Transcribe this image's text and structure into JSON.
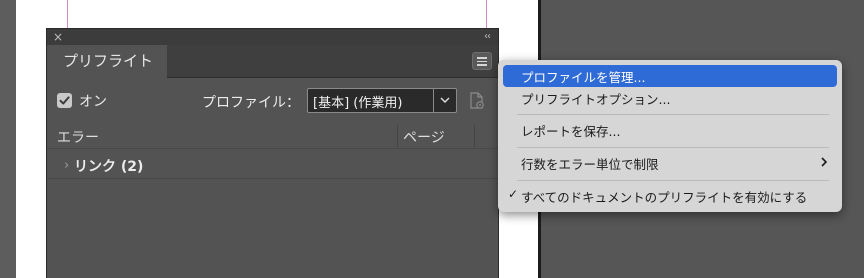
{
  "panel": {
    "tab_label": "プリフライト",
    "close_glyph": "×",
    "collapse_glyph": "‹‹",
    "on_label": "オン",
    "on_checked": true,
    "profile_label": "プロファイル：",
    "profile_value": "[基本] (作業用)",
    "columns": {
      "error": "エラー",
      "page": "ページ"
    },
    "rows": [
      {
        "label": "リンク (2)"
      }
    ]
  },
  "menu": {
    "items": [
      {
        "label": "プロファイルを管理...",
        "highlighted": true
      },
      {
        "label": "プリフライトオプション..."
      },
      {
        "label": "レポートを保存..."
      },
      {
        "label": "行数をエラー単位で制限",
        "submenu": true
      },
      {
        "label": "すべてのドキュメントのプリフライトを有効にする",
        "checked": true,
        "check_glyph": "✓"
      }
    ]
  },
  "colors": {
    "panel_bg": "#535353",
    "menu_bg": "#d6d6d6",
    "menu_highlight": "#2f6bd6",
    "margin_guide": "#d28ac7"
  },
  "icons": {
    "close": "close-icon",
    "collapse": "double-chevron-left-icon",
    "panel_menu": "hamburger-menu-icon",
    "dropdown": "chevron-down-icon",
    "define_profiles": "document-gear-icon",
    "disclosure": "chevron-right-icon",
    "submenu": "chevron-right-icon",
    "checkmark": "checkmark-icon"
  }
}
